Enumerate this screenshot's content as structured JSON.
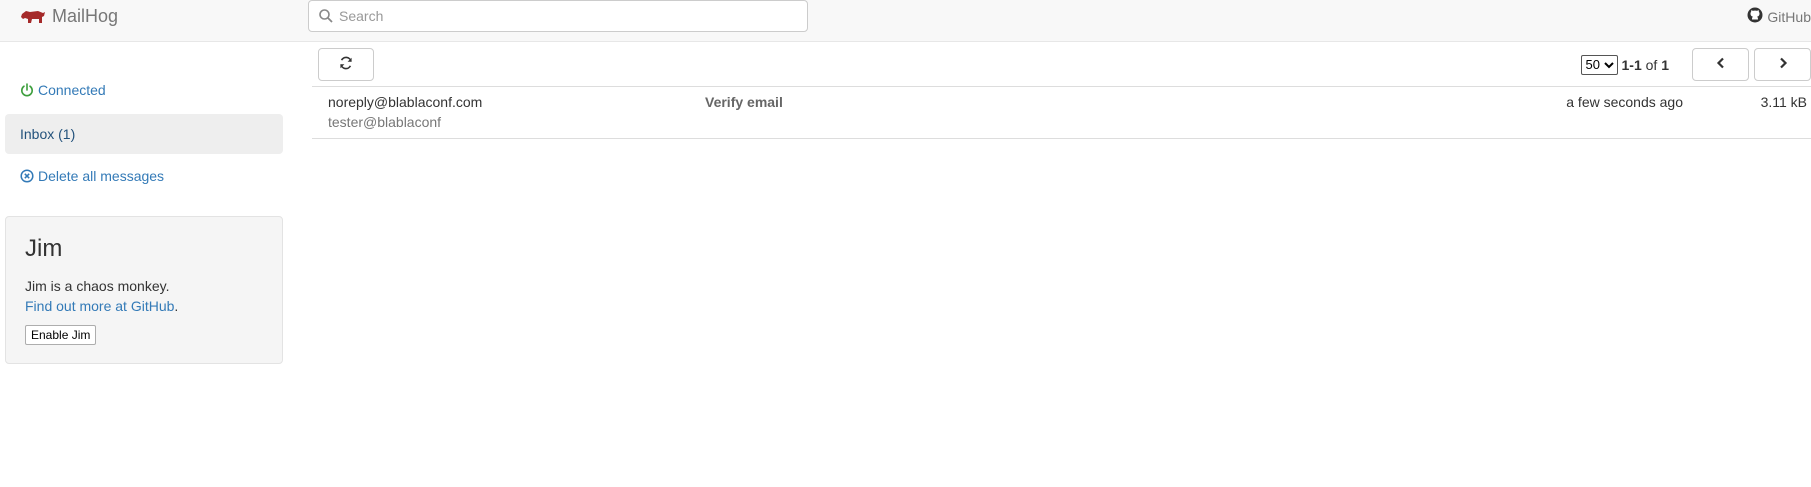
{
  "navbar": {
    "brand": "MailHog",
    "search_placeholder": "Search",
    "github_label": "GitHub"
  },
  "sidebar": {
    "connected_label": "Connected",
    "inbox_label": "Inbox (1)",
    "delete_label": "Delete all messages"
  },
  "jim": {
    "title": "Jim",
    "description": "Jim is a chaos monkey.",
    "link_text": "Find out more at GitHub",
    "link_suffix": ".",
    "button_label": "Enable Jim"
  },
  "toolbar": {
    "page_size_options": [
      "50"
    ],
    "page_size_selected": "50",
    "range": "1-1",
    "of_label": "of",
    "total": "1"
  },
  "messages": [
    {
      "from": "noreply@blablaconf.com",
      "to": "tester@blablaconf",
      "subject": "Verify email",
      "time": "a few seconds ago",
      "size": "3.11 kB"
    }
  ],
  "colors": {
    "link": "#337ab7",
    "connected": "#3c9e3c",
    "brand_icon": "#a52a2a"
  }
}
